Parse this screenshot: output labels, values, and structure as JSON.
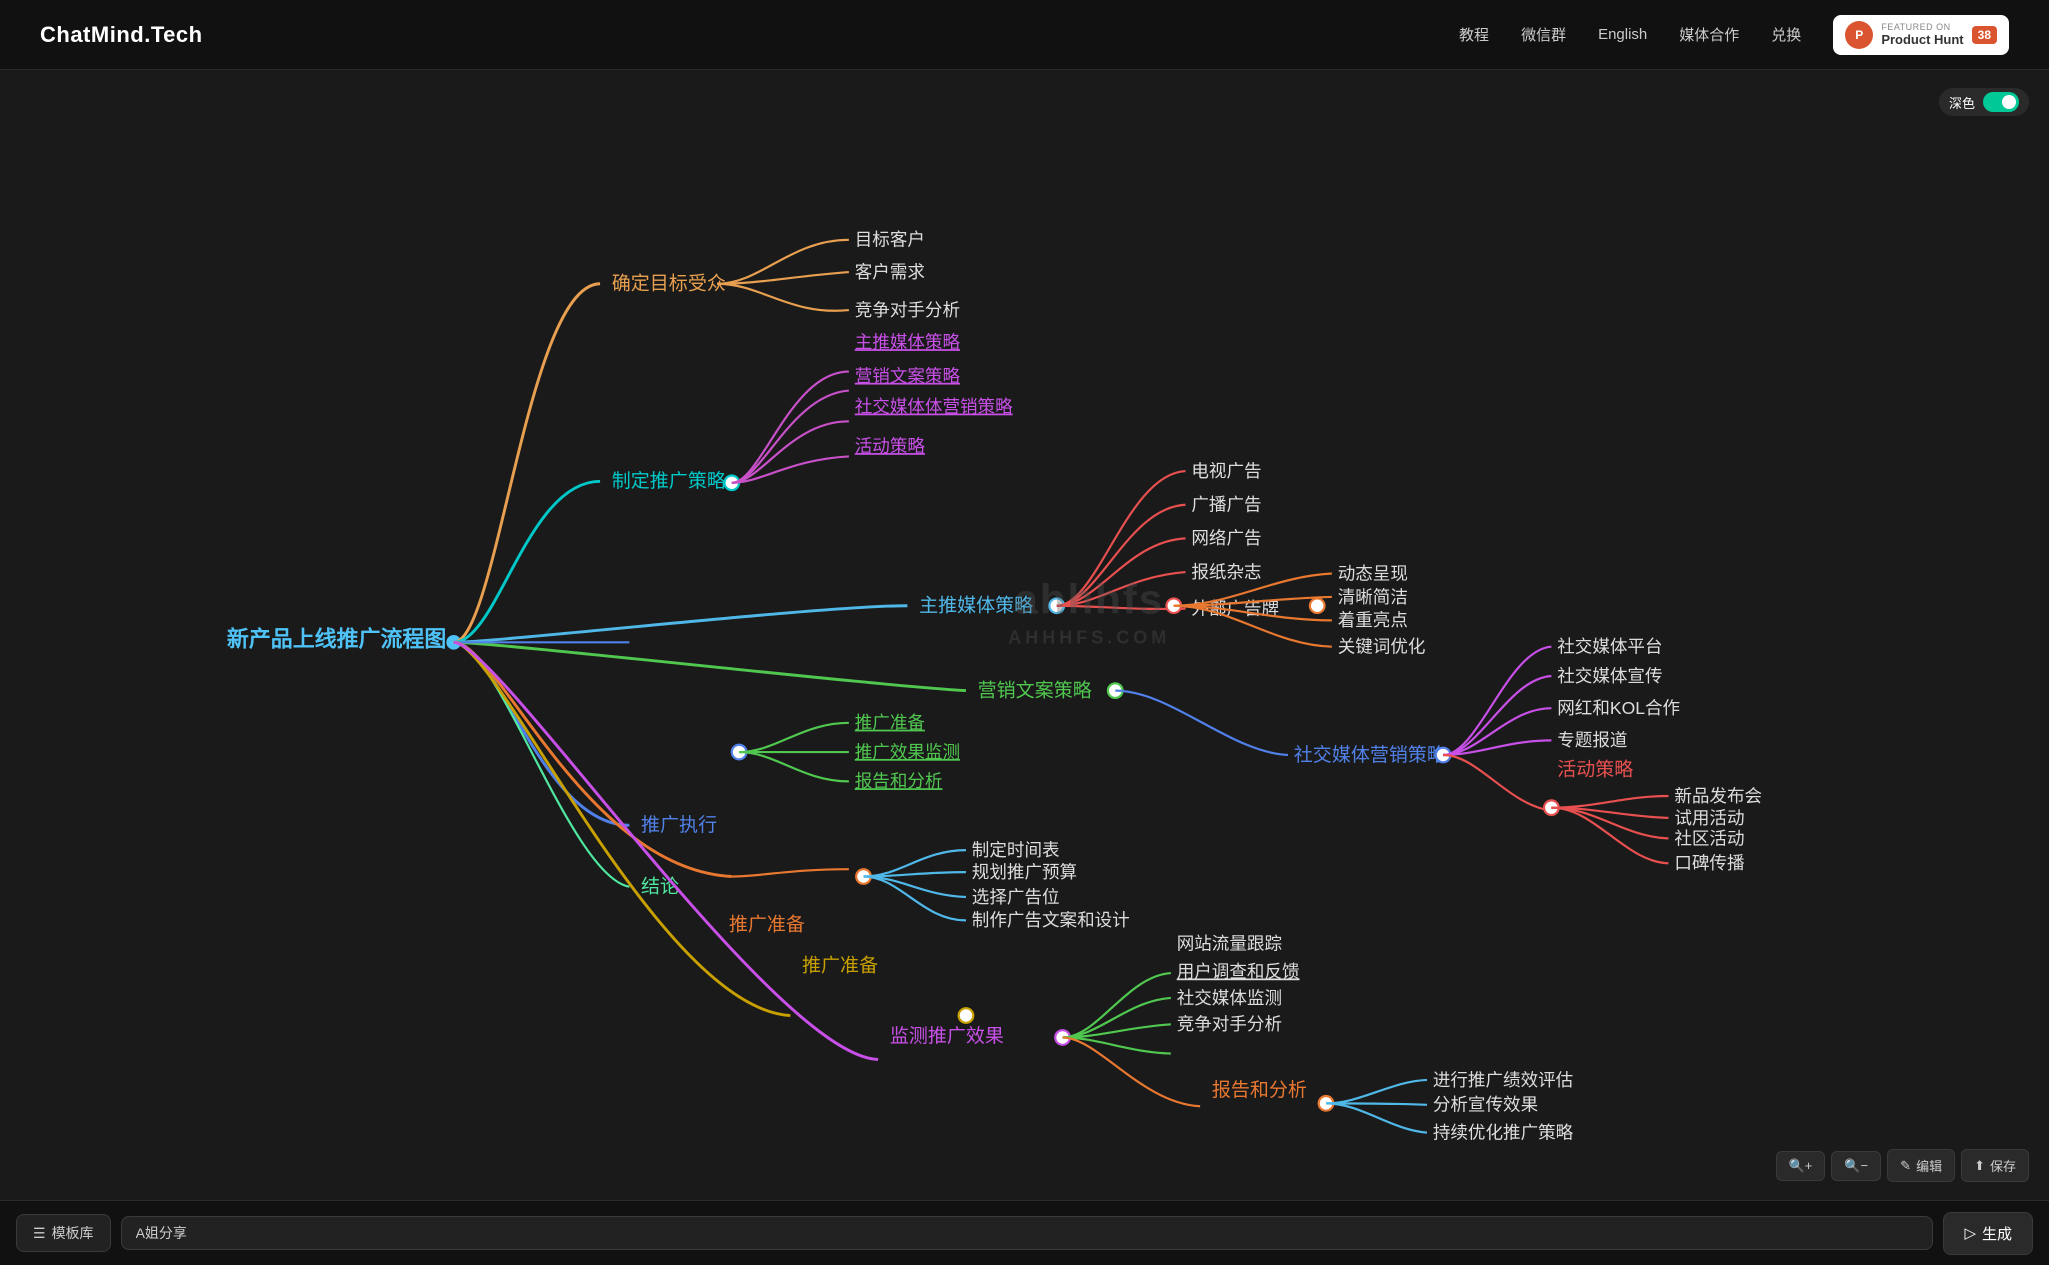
{
  "header": {
    "logo": "ChatMind.Tech",
    "nav": [
      {
        "label": "教程",
        "key": "tutorial"
      },
      {
        "label": "微信群",
        "key": "wechat"
      },
      {
        "label": "English",
        "key": "english"
      },
      {
        "label": "媒体合作",
        "key": "media"
      },
      {
        "label": "兑换",
        "key": "redeem"
      }
    ],
    "product_hunt": {
      "featured": "FEATURED ON",
      "name": "Product Hunt",
      "count": "38"
    }
  },
  "canvas": {
    "dark_toggle_label": "深色",
    "controls": {
      "zoom_in": "+",
      "zoom_out": "−",
      "edit": "编辑",
      "save": "保存"
    }
  },
  "footer": {
    "template_btn": "模板库",
    "input_placeholder": "A姐分享",
    "generate_btn": "生成"
  },
  "mindmap": {
    "root": "新产品上线推广流程图",
    "accent_colors": {
      "branch1": "#e8a050",
      "branch2": "#50b8e8",
      "branch3": "#e85050",
      "branch4": "#50e8a0",
      "teal": "#00c8c8",
      "purple": "#c850e8",
      "orange": "#e87830",
      "green": "#50c850",
      "blue": "#5080e8"
    }
  },
  "watermark": {
    "line1": "ahhhfs",
    "line2": "AHHHFS.COM"
  }
}
